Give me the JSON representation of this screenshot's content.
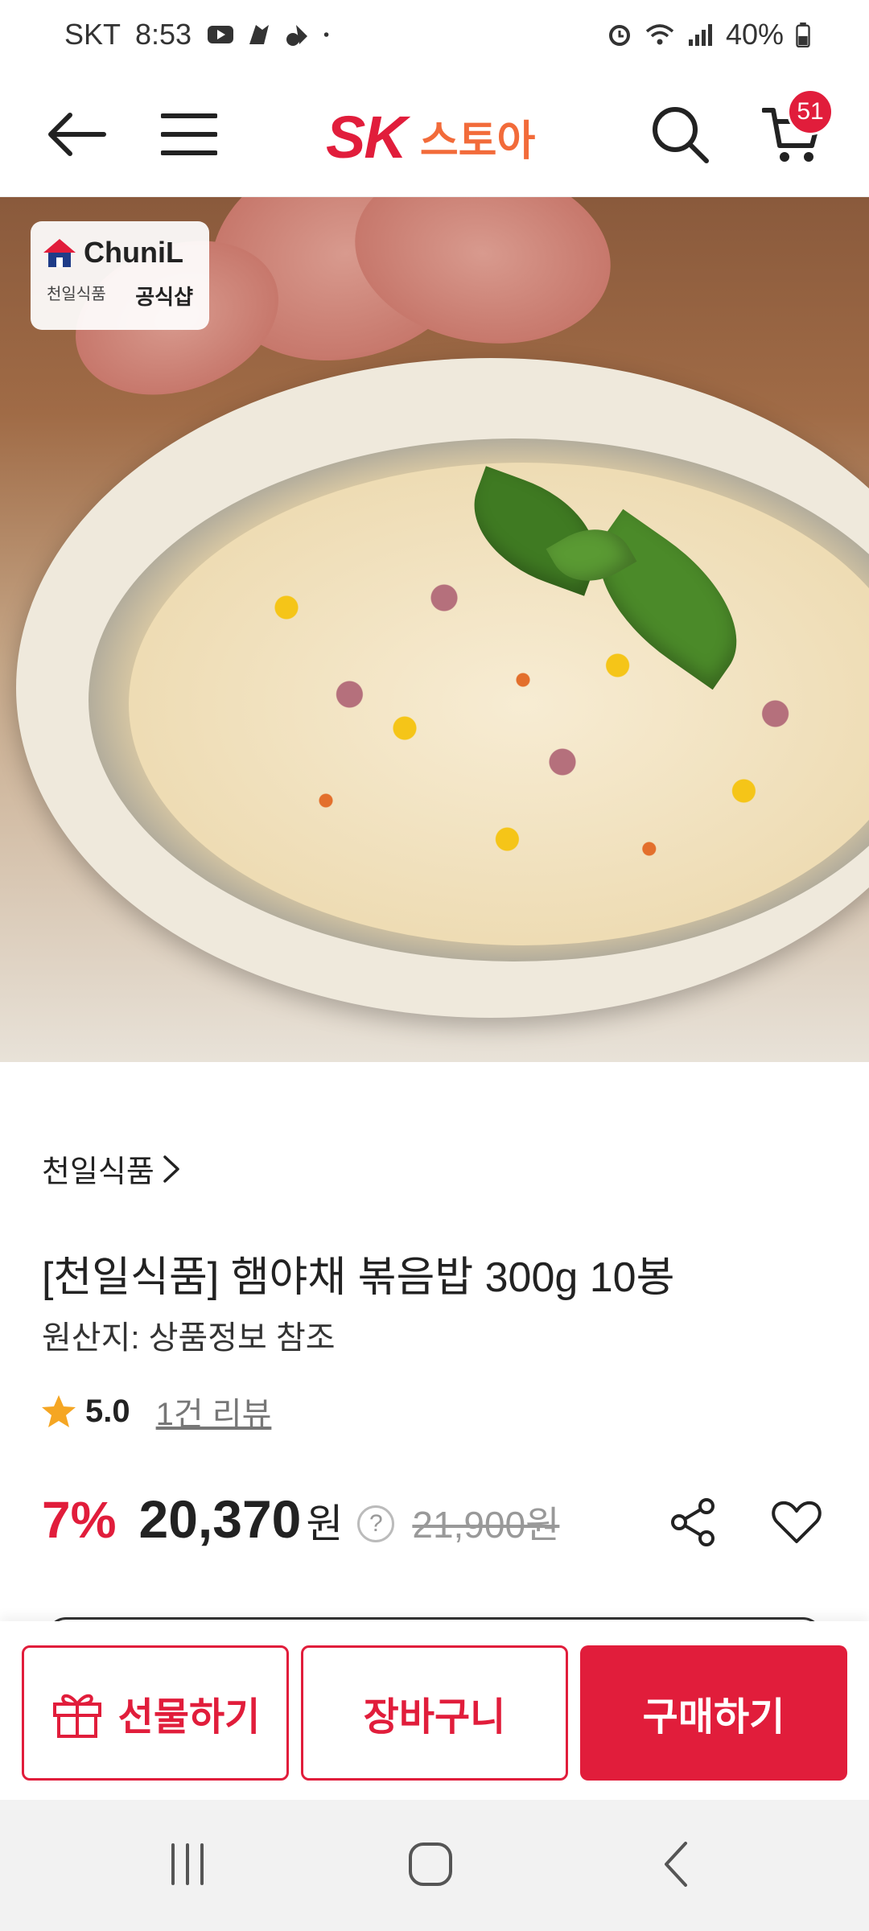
{
  "status_bar": {
    "carrier": "SKT",
    "time": "8:53",
    "battery": "40%",
    "icons": [
      "youtube-icon",
      "notification-icon",
      "notification-icon",
      "dot-icon",
      "alarm-icon",
      "wifi-icon",
      "signal-icon",
      "battery-icon"
    ]
  },
  "header": {
    "logo_brand": "SK",
    "logo_store": "스토아",
    "cart_count": "51",
    "colors": {
      "brand_red": "#e11d3b",
      "store_orange": "#f26b3a"
    }
  },
  "image": {
    "store_badge_brand": "ChuniL",
    "store_badge_brand_kr": "천일식품",
    "store_badge_official": "공식샵"
  },
  "product": {
    "seller": "천일식품",
    "title": "[천일식품] 햄야채 볶음밥 300g 10봉",
    "origin": "원산지: 상품정보 참조",
    "rating": "5.0",
    "reviews": "1건 리뷰",
    "discount": "7%",
    "price": "20,370",
    "currency": "원",
    "original_price": "21,900원",
    "help_symbol": "?"
  },
  "actions": {
    "gift": "선물하기",
    "cart": "장바구니",
    "buy": "구매하기"
  }
}
